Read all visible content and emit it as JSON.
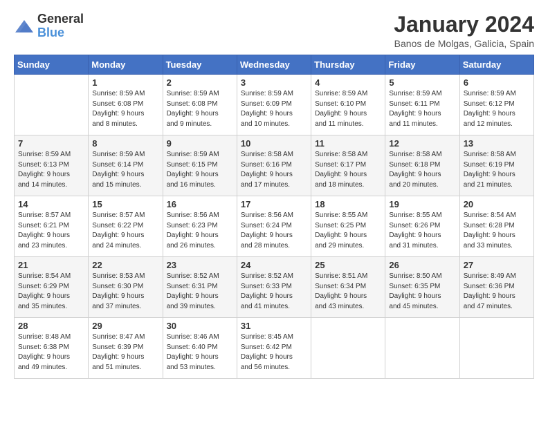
{
  "header": {
    "logo_general": "General",
    "logo_blue": "Blue",
    "title": "January 2024",
    "location": "Banos de Molgas, Galicia, Spain"
  },
  "weekdays": [
    "Sunday",
    "Monday",
    "Tuesday",
    "Wednesday",
    "Thursday",
    "Friday",
    "Saturday"
  ],
  "weeks": [
    [
      {
        "day": "",
        "sunrise": "",
        "sunset": "",
        "daylight": ""
      },
      {
        "day": "1",
        "sunrise": "Sunrise: 8:59 AM",
        "sunset": "Sunset: 6:08 PM",
        "daylight": "Daylight: 9 hours and 8 minutes."
      },
      {
        "day": "2",
        "sunrise": "Sunrise: 8:59 AM",
        "sunset": "Sunset: 6:08 PM",
        "daylight": "Daylight: 9 hours and 9 minutes."
      },
      {
        "day": "3",
        "sunrise": "Sunrise: 8:59 AM",
        "sunset": "Sunset: 6:09 PM",
        "daylight": "Daylight: 9 hours and 10 minutes."
      },
      {
        "day": "4",
        "sunrise": "Sunrise: 8:59 AM",
        "sunset": "Sunset: 6:10 PM",
        "daylight": "Daylight: 9 hours and 11 minutes."
      },
      {
        "day": "5",
        "sunrise": "Sunrise: 8:59 AM",
        "sunset": "Sunset: 6:11 PM",
        "daylight": "Daylight: 9 hours and 11 minutes."
      },
      {
        "day": "6",
        "sunrise": "Sunrise: 8:59 AM",
        "sunset": "Sunset: 6:12 PM",
        "daylight": "Daylight: 9 hours and 12 minutes."
      }
    ],
    [
      {
        "day": "7",
        "sunrise": "Sunrise: 8:59 AM",
        "sunset": "Sunset: 6:13 PM",
        "daylight": "Daylight: 9 hours and 14 minutes."
      },
      {
        "day": "8",
        "sunrise": "Sunrise: 8:59 AM",
        "sunset": "Sunset: 6:14 PM",
        "daylight": "Daylight: 9 hours and 15 minutes."
      },
      {
        "day": "9",
        "sunrise": "Sunrise: 8:59 AM",
        "sunset": "Sunset: 6:15 PM",
        "daylight": "Daylight: 9 hours and 16 minutes."
      },
      {
        "day": "10",
        "sunrise": "Sunrise: 8:58 AM",
        "sunset": "Sunset: 6:16 PM",
        "daylight": "Daylight: 9 hours and 17 minutes."
      },
      {
        "day": "11",
        "sunrise": "Sunrise: 8:58 AM",
        "sunset": "Sunset: 6:17 PM",
        "daylight": "Daylight: 9 hours and 18 minutes."
      },
      {
        "day": "12",
        "sunrise": "Sunrise: 8:58 AM",
        "sunset": "Sunset: 6:18 PM",
        "daylight": "Daylight: 9 hours and 20 minutes."
      },
      {
        "day": "13",
        "sunrise": "Sunrise: 8:58 AM",
        "sunset": "Sunset: 6:19 PM",
        "daylight": "Daylight: 9 hours and 21 minutes."
      }
    ],
    [
      {
        "day": "14",
        "sunrise": "Sunrise: 8:57 AM",
        "sunset": "Sunset: 6:21 PM",
        "daylight": "Daylight: 9 hours and 23 minutes."
      },
      {
        "day": "15",
        "sunrise": "Sunrise: 8:57 AM",
        "sunset": "Sunset: 6:22 PM",
        "daylight": "Daylight: 9 hours and 24 minutes."
      },
      {
        "day": "16",
        "sunrise": "Sunrise: 8:56 AM",
        "sunset": "Sunset: 6:23 PM",
        "daylight": "Daylight: 9 hours and 26 minutes."
      },
      {
        "day": "17",
        "sunrise": "Sunrise: 8:56 AM",
        "sunset": "Sunset: 6:24 PM",
        "daylight": "Daylight: 9 hours and 28 minutes."
      },
      {
        "day": "18",
        "sunrise": "Sunrise: 8:55 AM",
        "sunset": "Sunset: 6:25 PM",
        "daylight": "Daylight: 9 hours and 29 minutes."
      },
      {
        "day": "19",
        "sunrise": "Sunrise: 8:55 AM",
        "sunset": "Sunset: 6:26 PM",
        "daylight": "Daylight: 9 hours and 31 minutes."
      },
      {
        "day": "20",
        "sunrise": "Sunrise: 8:54 AM",
        "sunset": "Sunset: 6:28 PM",
        "daylight": "Daylight: 9 hours and 33 minutes."
      }
    ],
    [
      {
        "day": "21",
        "sunrise": "Sunrise: 8:54 AM",
        "sunset": "Sunset: 6:29 PM",
        "daylight": "Daylight: 9 hours and 35 minutes."
      },
      {
        "day": "22",
        "sunrise": "Sunrise: 8:53 AM",
        "sunset": "Sunset: 6:30 PM",
        "daylight": "Daylight: 9 hours and 37 minutes."
      },
      {
        "day": "23",
        "sunrise": "Sunrise: 8:52 AM",
        "sunset": "Sunset: 6:31 PM",
        "daylight": "Daylight: 9 hours and 39 minutes."
      },
      {
        "day": "24",
        "sunrise": "Sunrise: 8:52 AM",
        "sunset": "Sunset: 6:33 PM",
        "daylight": "Daylight: 9 hours and 41 minutes."
      },
      {
        "day": "25",
        "sunrise": "Sunrise: 8:51 AM",
        "sunset": "Sunset: 6:34 PM",
        "daylight": "Daylight: 9 hours and 43 minutes."
      },
      {
        "day": "26",
        "sunrise": "Sunrise: 8:50 AM",
        "sunset": "Sunset: 6:35 PM",
        "daylight": "Daylight: 9 hours and 45 minutes."
      },
      {
        "day": "27",
        "sunrise": "Sunrise: 8:49 AM",
        "sunset": "Sunset: 6:36 PM",
        "daylight": "Daylight: 9 hours and 47 minutes."
      }
    ],
    [
      {
        "day": "28",
        "sunrise": "Sunrise: 8:48 AM",
        "sunset": "Sunset: 6:38 PM",
        "daylight": "Daylight: 9 hours and 49 minutes."
      },
      {
        "day": "29",
        "sunrise": "Sunrise: 8:47 AM",
        "sunset": "Sunset: 6:39 PM",
        "daylight": "Daylight: 9 hours and 51 minutes."
      },
      {
        "day": "30",
        "sunrise": "Sunrise: 8:46 AM",
        "sunset": "Sunset: 6:40 PM",
        "daylight": "Daylight: 9 hours and 53 minutes."
      },
      {
        "day": "31",
        "sunrise": "Sunrise: 8:45 AM",
        "sunset": "Sunset: 6:42 PM",
        "daylight": "Daylight: 9 hours and 56 minutes."
      },
      {
        "day": "",
        "sunrise": "",
        "sunset": "",
        "daylight": ""
      },
      {
        "day": "",
        "sunrise": "",
        "sunset": "",
        "daylight": ""
      },
      {
        "day": "",
        "sunrise": "",
        "sunset": "",
        "daylight": ""
      }
    ]
  ]
}
